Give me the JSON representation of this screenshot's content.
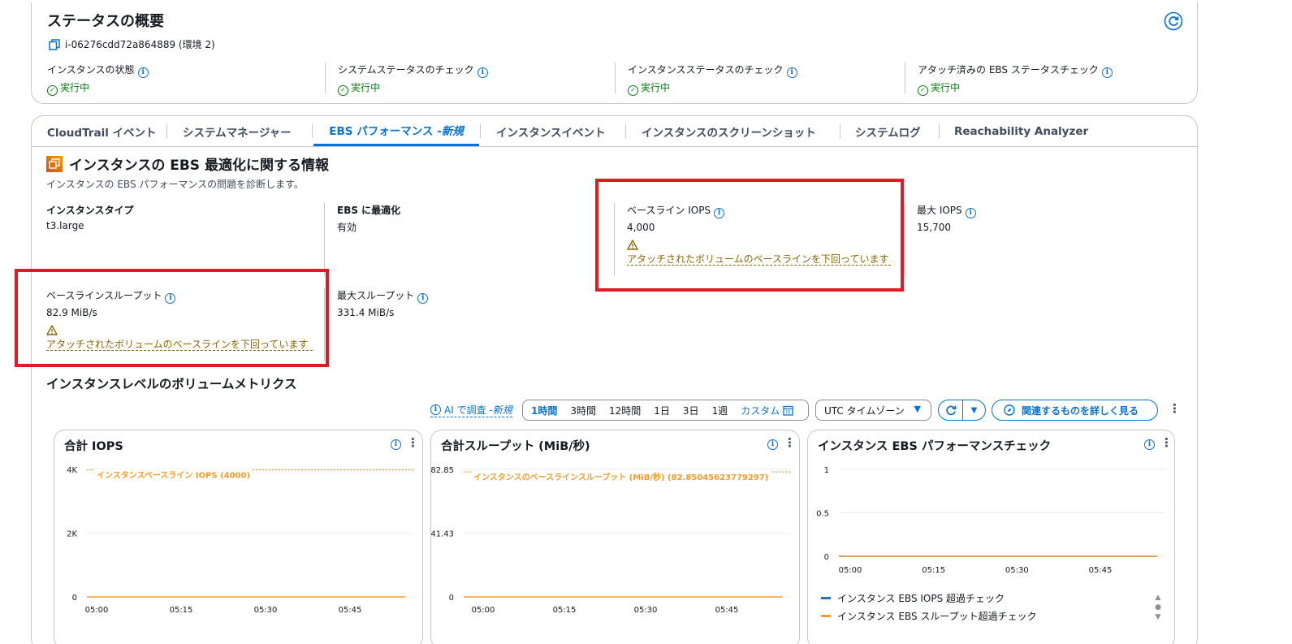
{
  "status": {
    "title": "ステータスの概要",
    "instance_id": "i-06276cdd72a864889 (環境 2)",
    "items": [
      {
        "label": "インスタンスの状態",
        "value": "実行中"
      },
      {
        "label": "システムステータスのチェック",
        "value": "実行中"
      },
      {
        "label": "インスタンスステータスのチェック",
        "value": "実行中"
      },
      {
        "label": "アタッチ済みの EBS ステータスチェック",
        "value": "実行中"
      }
    ]
  },
  "tabs": [
    {
      "label": "CloudTrail イベント"
    },
    {
      "label": "システムマネージャー"
    },
    {
      "label": "EBS パフォーマンス - ",
      "badge": "新規"
    },
    {
      "label": "インスタンスイベント"
    },
    {
      "label": "インスタンスのスクリーンショット"
    },
    {
      "label": "システムログ"
    },
    {
      "label": "Reachability Analyzer"
    }
  ],
  "ebs": {
    "title": "インスタンスの EBS 最適化に関する情報",
    "subtitle": "インスタンスの EBS パフォーマンスの問題を診断します。",
    "instance_type_label": "インスタンスタイプ",
    "instance_type_value": "t3.large",
    "ebs_opt_label": "EBS に最適化",
    "ebs_opt_value": "有効",
    "baseline_iops_label": "ベースライン IOPS",
    "baseline_iops_value": "4,000",
    "warning": "アタッチされたボリュームのベースラインを下回っています",
    "max_iops_label": "最大 IOPS",
    "max_iops_value": "15,700",
    "baseline_tp_label": "ベースラインスループット",
    "baseline_tp_value": "82.9 MiB/s",
    "max_tp_label": "最大スループット",
    "max_tp_value": "331.4 MiB/s"
  },
  "metrics": {
    "title": "インスタンスレベルのボリュームメトリクス",
    "ai_label": "AI で調査 - ",
    "ai_badge": "新規",
    "ranges": [
      "1時間",
      "3時間",
      "12時間",
      "1日",
      "3日",
      "1週",
      "カスタム"
    ],
    "selected_range": "1時間",
    "timezone": "UTC タイムゾーン",
    "explore": "関連するものを詳しく見る"
  },
  "colors": {
    "accent": "#0972d3",
    "ok": "#037f0c",
    "warn": "#8d6605",
    "highlight": "#e01b24",
    "series_orange": "#f89b29",
    "series_blue": "#1f77b4"
  },
  "chart_data": [
    {
      "type": "line",
      "title": "合計 IOPS",
      "x": [
        "05:00",
        "05:15",
        "05:30",
        "05:45"
      ],
      "yticks": [
        "4K",
        "2K",
        "0"
      ],
      "ylim": [
        0,
        4000
      ],
      "baseline": {
        "name": "インスタンスベースライン IOPS (4000)",
        "value": 4000
      },
      "series": [
        {
          "values": [
            0,
            0,
            0,
            0
          ]
        }
      ]
    },
    {
      "type": "line",
      "title": "合計スループット (MiB/秒)",
      "x": [
        "05:00",
        "05:15",
        "05:30",
        "05:45"
      ],
      "yticks": [
        "82.85",
        "41.43",
        "0"
      ],
      "ylim": [
        0,
        82.85
      ],
      "baseline": {
        "name": "インスタンスのベースラインスループット (MiB/秒) (82.85045623779297)",
        "value": 82.85
      },
      "series": [
        {
          "values": [
            0,
            0,
            0,
            0
          ]
        }
      ]
    },
    {
      "type": "line",
      "title": "インスタンス EBS パフォーマンスチェック",
      "x": [
        "05:00",
        "05:15",
        "05:30",
        "05:45"
      ],
      "yticks": [
        "1",
        "0.5",
        "0"
      ],
      "ylim": [
        0,
        1
      ],
      "series": [
        {
          "name": "インスタンス EBS IOPS 超過チェック",
          "values": [
            0,
            0,
            0,
            0
          ]
        },
        {
          "name": "インスタンス EBS スループット超過チェック",
          "values": [
            0,
            0,
            0,
            0
          ]
        }
      ]
    }
  ]
}
